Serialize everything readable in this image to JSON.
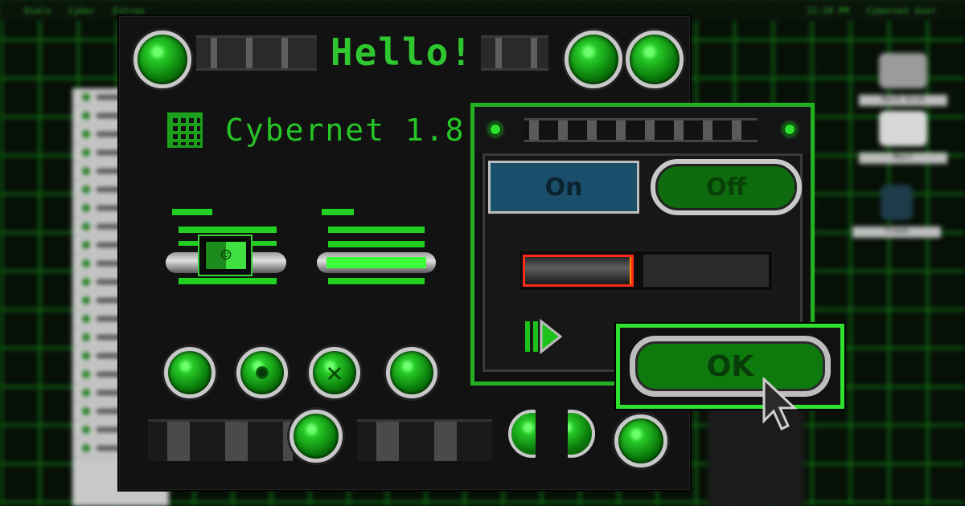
{
  "menubar": {
    "items": [
      "Dials",
      "Cyber",
      "Extras"
    ],
    "clock": "12:34 PM",
    "user": "Cybernet User"
  },
  "desktop_icons": [
    "Hard Disk",
    "Mail",
    "Trash"
  ],
  "main_window": {
    "title": "Hello!",
    "app_name": "Cybernet 1.8"
  },
  "dialog": {
    "on_label": "On",
    "off_label": "Off",
    "progress": 0.45
  },
  "ok_button": {
    "label": "OK"
  },
  "colors": {
    "accent_green": "#2fc72f",
    "selected_blue": "#1a4f6c",
    "progress_border": "#ff2a1a",
    "background": "#050805"
  },
  "icons": {
    "orb": "green-orb-icon",
    "grid": "grid-icon",
    "finder": "finder-face-icon",
    "play": "play-step-icon",
    "cursor": "arrow-cursor-icon"
  }
}
